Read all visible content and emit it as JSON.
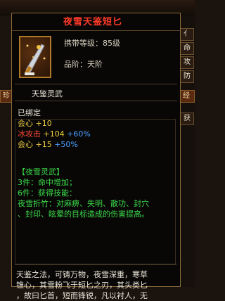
{
  "title": "夜雪天鉴短匕",
  "stats": {
    "level_label": "携带等级：85级",
    "grade_label": "品阶：天阶"
  },
  "item_name": "天鉴灵武",
  "bound": "已绑定",
  "attributes": [
    {
      "label": "会心",
      "value": "+10",
      "extra": ""
    },
    {
      "label": "冰攻击",
      "value": "+104",
      "extra": "+60%"
    },
    {
      "label": "会心",
      "value": "+15",
      "extra": "+50%"
    }
  ],
  "set": {
    "name": "【夜雪灵武】",
    "piece3": "3件：命中增加；",
    "piece6": "6件：获得技能：",
    "skill_text_1": "夜雪折竹：对麻痹、失明、散功、封穴",
    "skill_text_2": "、封印、眩晕的目标造成的伤害提高。"
  },
  "description": {
    "line1": "天鉴之法，可铸万物，夜雪深重，寒草",
    "line2": "锥心，其雪粉飞于短匕之刃，其头类匕",
    "line3": "，故曰匕首，短而锋锐，凡以衬人，无"
  },
  "side_tabs": [
    "亻",
    "命",
    "攻",
    "防",
    "获"
  ],
  "left_tab": "珍",
  "right_tab": "经"
}
